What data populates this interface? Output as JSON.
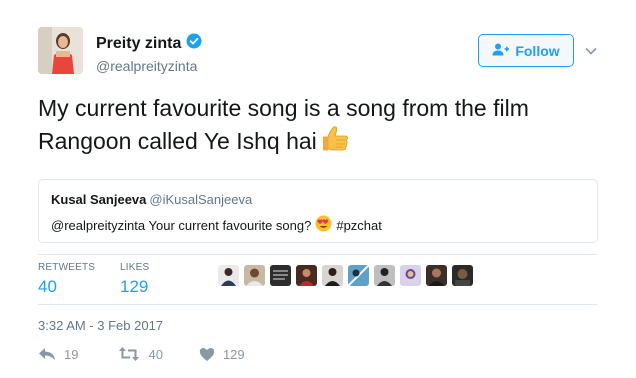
{
  "author": {
    "name": "Preity zinta",
    "handle": "@realpreityzinta",
    "verified": true
  },
  "follow_button": {
    "label": "Follow"
  },
  "tweet": {
    "text": "My current favourite song is a song from the film Rangoon called Ye Ishq hai",
    "emoji": "thumbs-up-emoji"
  },
  "quoted_tweet": {
    "name": "Kusal Sanjeeva",
    "handle": "@iKusalSanjeeva",
    "text_before": "@realpreityzinta Your current favourite song?",
    "emoji": "heart-eyes-emoji",
    "text_after": "#pzchat"
  },
  "stats": {
    "retweets_label": "RETWEETS",
    "retweets_value": "40",
    "likes_label": "LIKES",
    "likes_value": "129"
  },
  "likers": [
    "liker-1",
    "liker-2",
    "liker-3",
    "liker-4",
    "liker-5",
    "liker-6",
    "liker-7",
    "liker-8",
    "liker-9",
    "liker-10"
  ],
  "timestamp": "3:32 AM - 3 Feb 2017",
  "actions": {
    "reply_count": "19",
    "retweet_count": "40",
    "like_count": "129"
  },
  "colors": {
    "accent": "#1da1f2",
    "muted": "#657786",
    "action_icon": "#8899a6"
  }
}
